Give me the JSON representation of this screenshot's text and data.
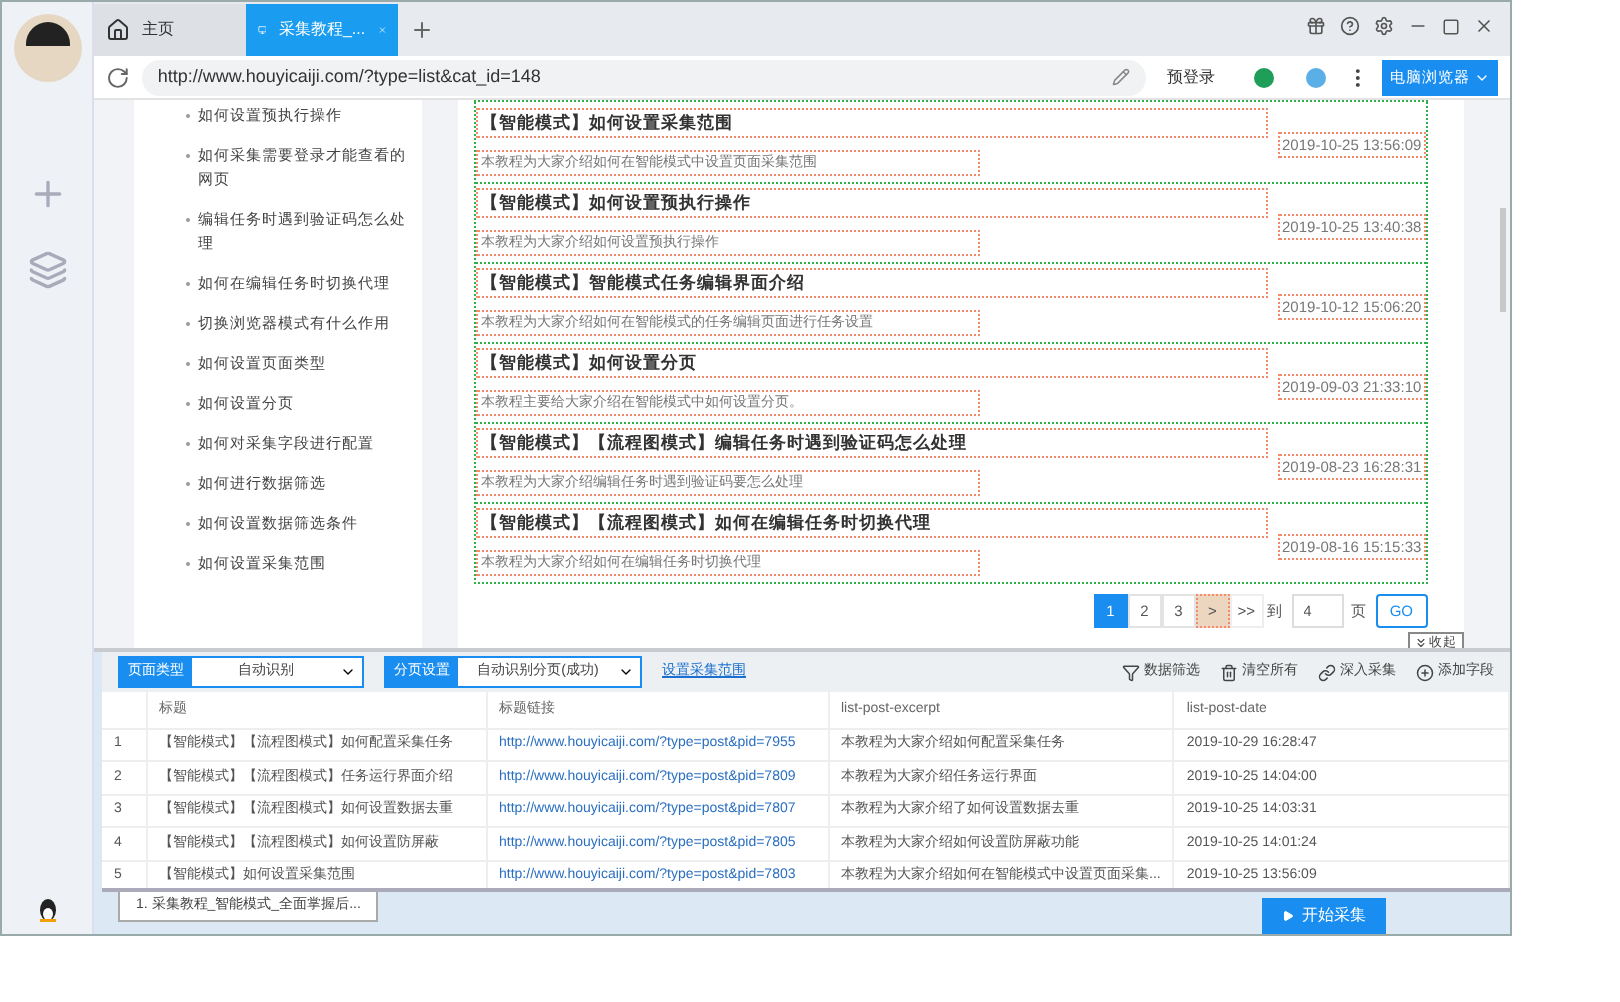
{
  "tabs": [
    {
      "label": "主页",
      "kind": "home",
      "selected": false
    },
    {
      "label": "采集教程_...",
      "kind": "page",
      "selected": true
    }
  ],
  "toolbar": {
    "url": "http://www.houyicaiji.com/?type=list&cat_id=148",
    "login": "预登录",
    "browser_mode": "电脑浏览器"
  },
  "sidebar": {
    "items": [
      "如何设置预执行操作",
      "如何采集需要登录才能查看的网页",
      "编辑任务时遇到验证码怎么处理",
      "如何在编辑任务时切换代理",
      "切换浏览器模式有什么作用",
      "如何设置页面类型",
      "如何设置分页",
      "如何对采集字段进行配置",
      "如何进行数据筛选",
      "如何设置数据筛选条件",
      "如何设置采集范围"
    ]
  },
  "articles": [
    {
      "title": "【智能模式】如何设置采集范围",
      "excerpt": "本教程为大家介绍如何在智能模式中设置页面采集范围",
      "date": "2019-10-25 13:56:09"
    },
    {
      "title": "【智能模式】如何设置预执行操作",
      "excerpt": "本教程为大家介绍如何设置预执行操作",
      "date": "2019-10-25 13:40:38"
    },
    {
      "title": "【智能模式】智能模式任务编辑界面介绍",
      "excerpt": "本教程为大家介绍如何在智能模式的任务编辑页面进行任务设置",
      "date": "2019-10-12 15:06:20"
    },
    {
      "title": "【智能模式】如何设置分页",
      "excerpt": "本教程主要给大家介绍在智能模式中如何设置分页。",
      "date": "2019-09-03 21:33:10"
    },
    {
      "title": "【智能模式】【流程图模式】编辑任务时遇到验证码怎么处理",
      "excerpt": "本教程为大家介绍编辑任务时遇到验证码要怎么处理",
      "date": "2019-08-23 16:28:31"
    },
    {
      "title": "【智能模式】【流程图模式】如何在编辑任务时切换代理",
      "excerpt": "本教程为大家介绍如何在编辑任务时切换代理",
      "date": "2019-08-16 15:15:33"
    }
  ],
  "pagination": {
    "pages": [
      {
        "label": "1",
        "selected": true
      },
      {
        "label": "2",
        "selected": false
      },
      {
        "label": "3",
        "selected": false
      }
    ],
    "next": ">",
    "last": ">>",
    "goto_label": "到",
    "goto_value": "4",
    "page_suffix": "页",
    "go": "GO",
    "collapse": "收起"
  },
  "panel": {
    "page_type_label": "页面类型",
    "page_type_value": "自动识别",
    "paging_label": "分页设置",
    "paging_value": "自动识别分页(成功)",
    "range_link": "设置采集范围",
    "actions": [
      "数据筛选",
      "清空所有",
      "深入采集",
      "添加字段"
    ],
    "table": {
      "columns": [
        "",
        "标题",
        "标题链接",
        "list-post-excerpt",
        "list-post-date"
      ],
      "rows": [
        [
          "1",
          "【智能模式】【流程图模式】如何配置采集任务",
          "http://www.houyicaiji.com/?type=post&pid=7955",
          "本教程为大家介绍如何配置采集任务",
          "2019-10-29 16:28:47"
        ],
        [
          "2",
          "【智能模式】【流程图模式】任务运行界面介绍",
          "http://www.houyicaiji.com/?type=post&pid=7809",
          "本教程为大家介绍任务运行界面",
          "2019-10-25 14:04:00"
        ],
        [
          "3",
          "【智能模式】【流程图模式】如何设置数据去重",
          "http://www.houyicaiji.com/?type=post&pid=7807",
          "本教程为大家介绍了如何设置数据去重",
          "2019-10-25 14:03:31"
        ],
        [
          "4",
          "【智能模式】【流程图模式】如何设置防屏蔽",
          "http://www.houyicaiji.com/?type=post&pid=7805",
          "本教程为大家介绍如何设置防屏蔽功能",
          "2019-10-25 14:01:24"
        ],
        [
          "5",
          "【智能模式】如何设置采集范围",
          "http://www.houyicaiji.com/?type=post&pid=7803",
          "本教程为大家介绍如何在智能模式中设置页面采集...",
          "2019-10-25 13:56:09"
        ]
      ]
    }
  },
  "footer": {
    "task": "1. 采集教程_智能模式_全面掌握后...",
    "start": "开始采集"
  }
}
